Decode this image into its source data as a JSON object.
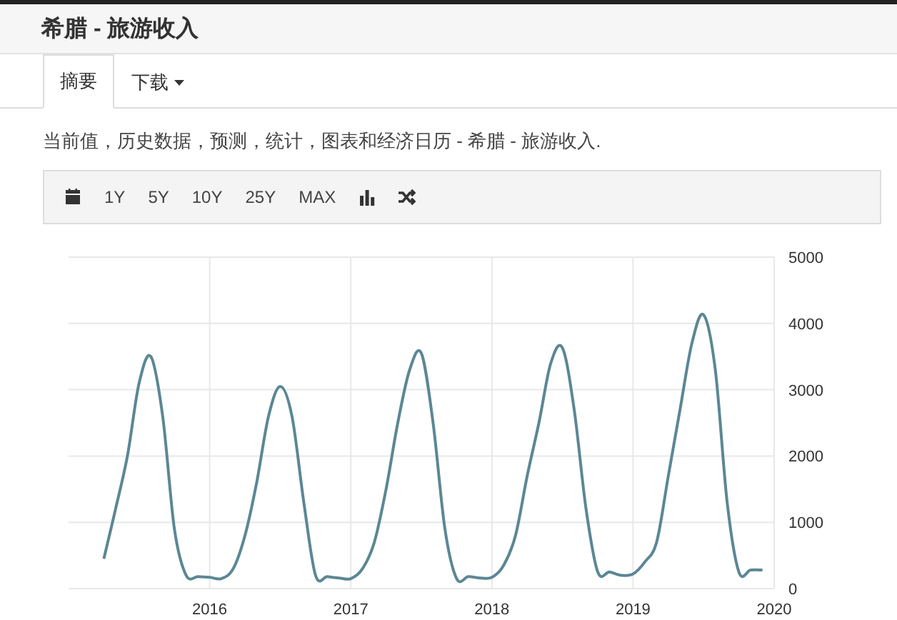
{
  "window": {
    "title": "希腊 - 旅游收入"
  },
  "tabs": [
    {
      "label": "摘要",
      "selected": true,
      "kind": "plain"
    },
    {
      "label": "下载",
      "selected": false,
      "kind": "dropdown"
    }
  ],
  "description": "当前值，历史数据，预测，统计，图表和经济日历 - 希腊 - 旅游收入.",
  "toolbar": [
    {
      "kind": "calendar"
    },
    {
      "kind": "range",
      "label": "1Y"
    },
    {
      "kind": "range",
      "label": "5Y"
    },
    {
      "kind": "range",
      "label": "10Y"
    },
    {
      "kind": "range",
      "label": "25Y"
    },
    {
      "kind": "range",
      "label": "MAX"
    },
    {
      "kind": "bars"
    },
    {
      "kind": "shuffle"
    }
  ],
  "chart": {
    "chart_data": {
      "type": "line",
      "grid": true,
      "xlim": [
        2015,
        2020
      ],
      "ylim": [
        0,
        5000
      ],
      "xticks": [
        2016,
        2017,
        2018,
        2019,
        2020
      ],
      "yticks": [
        0,
        1000,
        2000,
        3000,
        4000,
        5000
      ],
      "x": [
        2015.25,
        2015.333,
        2015.417,
        2015.5,
        2015.583,
        2015.667,
        2015.75,
        2015.833,
        2015.917,
        2016,
        2016.083,
        2016.167,
        2016.25,
        2016.333,
        2016.417,
        2016.5,
        2016.583,
        2016.667,
        2016.75,
        2016.833,
        2016.917,
        2017,
        2017.083,
        2017.167,
        2017.25,
        2017.333,
        2017.417,
        2017.5,
        2017.583,
        2017.667,
        2017.75,
        2017.833,
        2017.917,
        2018,
        2018.083,
        2018.167,
        2018.25,
        2018.333,
        2018.417,
        2018.5,
        2018.583,
        2018.667,
        2018.75,
        2018.833,
        2018.917,
        2019,
        2019.083,
        2019.167,
        2019.25,
        2019.333,
        2019.417,
        2019.5,
        2019.583,
        2019.667,
        2019.75,
        2019.833,
        2019.917
      ],
      "series": [
        {
          "color": "#5b8794",
          "values": [
            450,
            1200,
            2000,
            3100,
            3500,
            2600,
            900,
            200,
            180,
            170,
            150,
            300,
            800,
            1600,
            2600,
            3050,
            2600,
            1300,
            200,
            180,
            160,
            150,
            300,
            700,
            1500,
            2500,
            3300,
            3550,
            2500,
            900,
            150,
            180,
            160,
            170,
            350,
            800,
            1700,
            2500,
            3400,
            3630,
            2700,
            1200,
            250,
            250,
            200,
            220,
            400,
            700,
            1700,
            2700,
            3700,
            4130,
            3300,
            1300,
            250,
            280,
            280
          ]
        }
      ]
    }
  }
}
